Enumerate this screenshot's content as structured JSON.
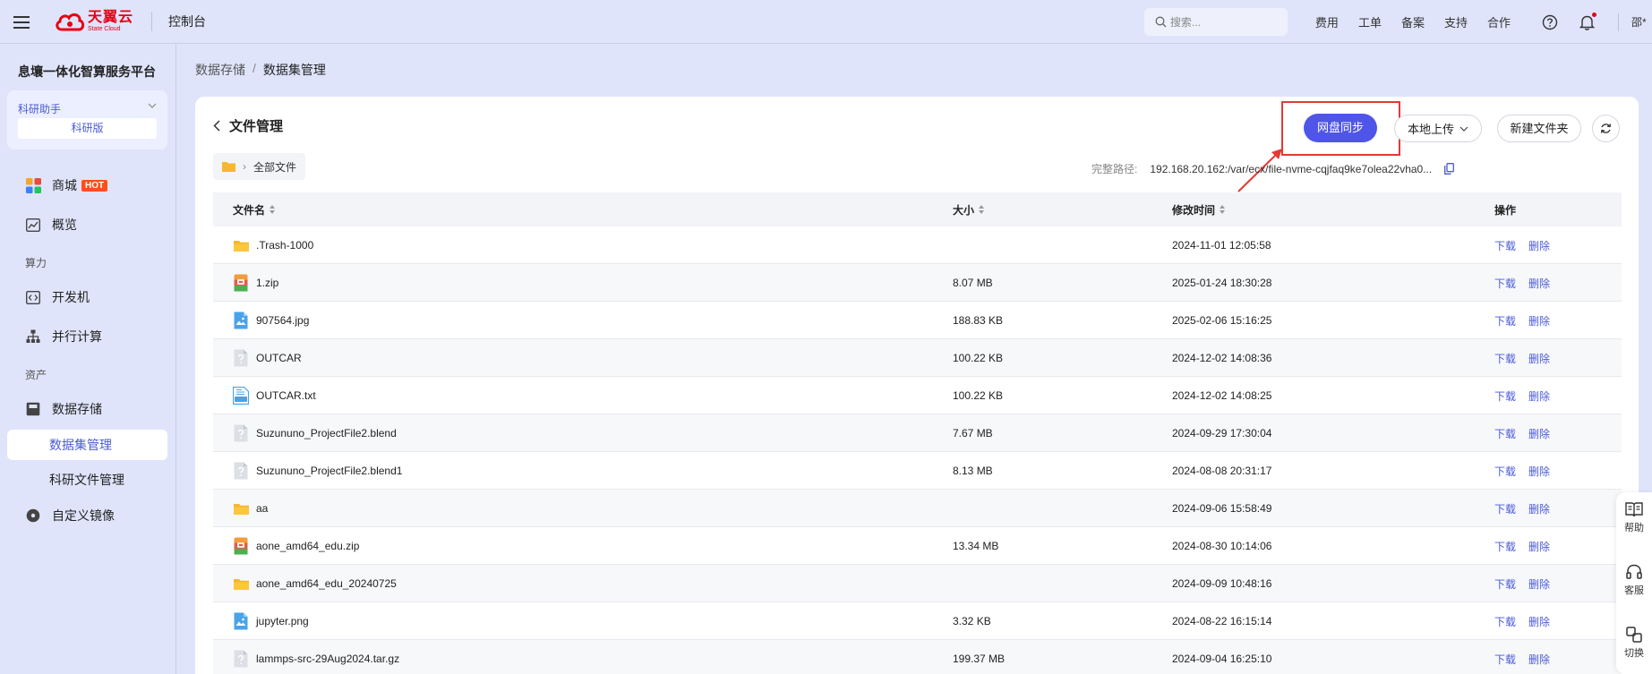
{
  "header": {
    "logo_main": "天翼云",
    "logo_sub": "State Cloud",
    "console": "控制台",
    "search_placeholder": "搜索...",
    "links": [
      "费用",
      "工单",
      "备案",
      "支持",
      "合作"
    ],
    "user": "邵*"
  },
  "sidebar": {
    "platform_title": "息壤一体化智算服务平台",
    "assistant": "科研助手",
    "edition": "科研版",
    "items": {
      "mall": "商城",
      "hot": "HOT",
      "overview": "概览",
      "group_compute": "算力",
      "devbox": "开发机",
      "parallel": "并行计算",
      "group_assets": "资产",
      "storage": "数据存储",
      "dataset_mgmt": "数据集管理",
      "research_files": "科研文件管理",
      "custom_image": "自定义镜像"
    }
  },
  "breadcrumb": [
    "数据存储",
    "数据集管理"
  ],
  "panel": {
    "title": "文件管理",
    "sync_button": "网盘同步",
    "upload_button": "本地上传",
    "new_folder_button": "新建文件夹",
    "crumb": "全部文件",
    "path_label": "完整路径:",
    "path_value": "192.168.20.162:/var/ecx/file-nvme-cqjfaq9ke7olea22vha0..."
  },
  "table": {
    "headers": {
      "name": "文件名",
      "size": "大小",
      "time": "修改时间",
      "ops": "操作"
    },
    "download": "下载",
    "delete": "删除",
    "rows": [
      {
        "name": ".Trash-1000",
        "size": "",
        "time": "2024-11-01 12:05:58",
        "icon": "folder-icon"
      },
      {
        "name": "1.zip",
        "size": "8.07 MB",
        "time": "2025-01-24 18:30:28",
        "icon": "zip-icon"
      },
      {
        "name": "907564.jpg",
        "size": "188.83 KB",
        "time": "2025-02-06 15:16:25",
        "icon": "image-icon"
      },
      {
        "name": "OUTCAR",
        "size": "100.22 KB",
        "time": "2024-12-02 14:08:36",
        "icon": "unknown-file-icon"
      },
      {
        "name": "OUTCAR.txt",
        "size": "100.22 KB",
        "time": "2024-12-02 14:08:25",
        "icon": "txt-icon"
      },
      {
        "name": "Suzununo_ProjectFile2.blend",
        "size": "7.67 MB",
        "time": "2024-09-29 17:30:04",
        "icon": "unknown-file-icon"
      },
      {
        "name": "Suzununo_ProjectFile2.blend1",
        "size": "8.13 MB",
        "time": "2024-08-08 20:31:17",
        "icon": "unknown-file-icon"
      },
      {
        "name": "aa",
        "size": "",
        "time": "2024-09-06 15:58:49",
        "icon": "folder-icon"
      },
      {
        "name": "aone_amd64_edu.zip",
        "size": "13.34 MB",
        "time": "2024-08-30 10:14:06",
        "icon": "zip-icon"
      },
      {
        "name": "aone_amd64_edu_20240725",
        "size": "",
        "time": "2024-09-09 10:48:16",
        "icon": "folder-icon"
      },
      {
        "name": "jupyter.png",
        "size": "3.32 KB",
        "time": "2024-08-22 16:15:14",
        "icon": "image-icon"
      },
      {
        "name": "lammps-src-29Aug2024.tar.gz",
        "size": "199.37 MB",
        "time": "2024-09-04 16:25:10",
        "icon": "unknown-file-icon"
      }
    ]
  },
  "float_bar": {
    "help": "帮助",
    "service": "客服",
    "switch": "切换"
  },
  "colors": {
    "accent": "#4f55e8",
    "brand_red": "#e60012",
    "link": "#4a5bd6",
    "highlight": "#e53935"
  }
}
